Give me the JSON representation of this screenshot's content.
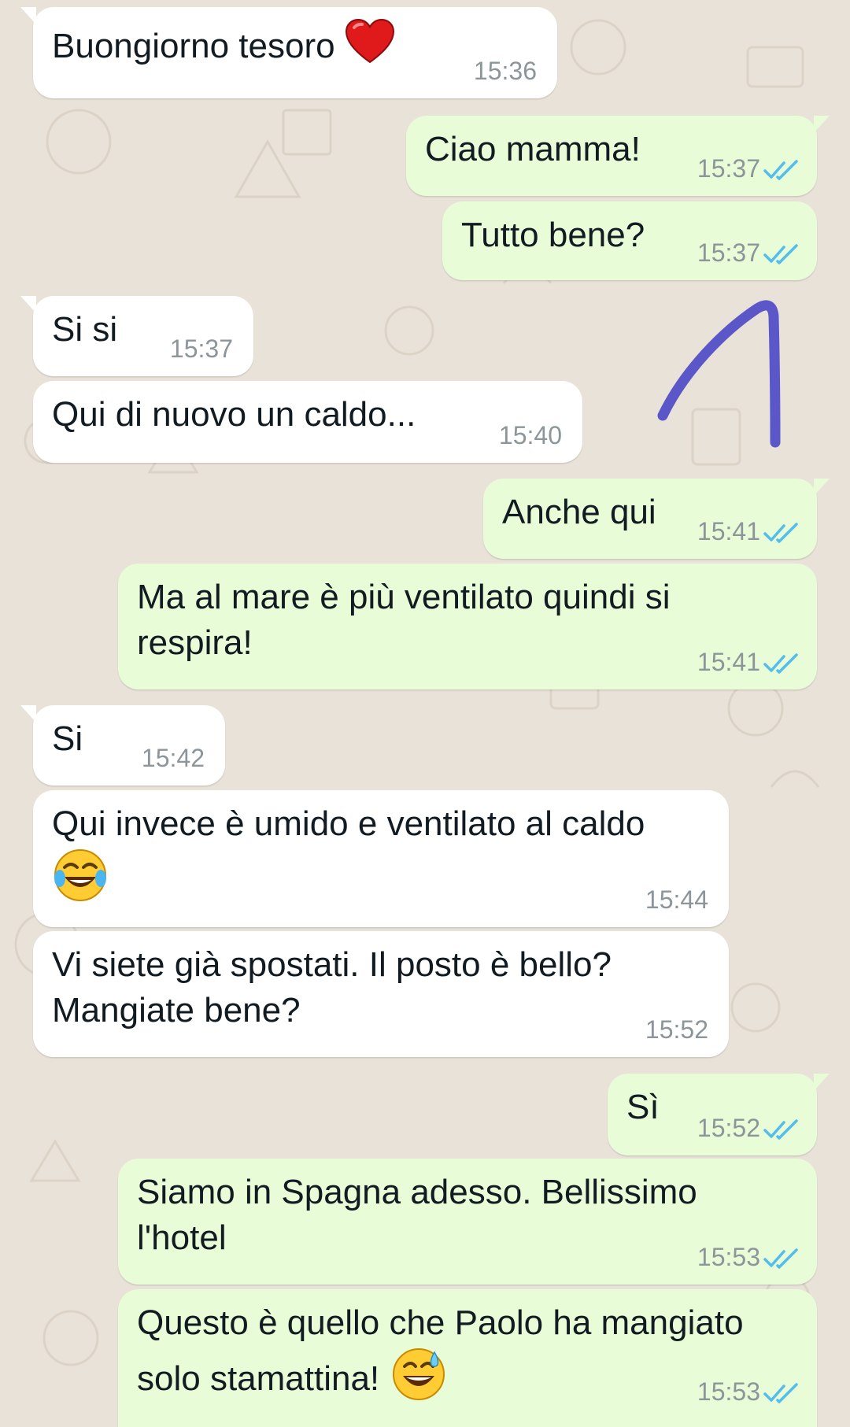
{
  "chat": {
    "messages": [
      {
        "dir": "in",
        "text": "Buongiorno tesoro",
        "emoji": "red-heart",
        "time": "15:36"
      },
      {
        "dir": "out",
        "text": "Ciao mamma!",
        "time": "15:37",
        "status": "read"
      },
      {
        "dir": "out",
        "text": "Tutto bene?",
        "time": "15:37",
        "status": "read"
      },
      {
        "dir": "in",
        "text": "Si si",
        "time": "15:37"
      },
      {
        "dir": "in",
        "text": "Qui di nuovo un caldo...",
        "time": "15:40"
      },
      {
        "dir": "out",
        "text": "Anche qui",
        "time": "15:41",
        "status": "read"
      },
      {
        "dir": "out",
        "text": "Ma al mare è più ventilato quindi si\nrespira!",
        "time": "15:41",
        "status": "read"
      },
      {
        "dir": "in",
        "text": "Si",
        "time": "15:42"
      },
      {
        "dir": "in",
        "text": "Qui invece è umido e ventilato al caldo",
        "emoji": "face-with-tears-of-joy",
        "time": "15:44"
      },
      {
        "dir": "in",
        "text": "Vi siete già spostati. Il posto è bello?\nMangiate bene?",
        "time": "15:52"
      },
      {
        "dir": "out",
        "text": "Sì",
        "time": "15:52",
        "status": "read"
      },
      {
        "dir": "out",
        "text": "Siamo in Spagna adesso. Bellissimo\nl'hotel",
        "time": "15:53",
        "status": "read"
      },
      {
        "dir": "out",
        "text": "Questo è quello che Paolo ha mangiato\nsolo stamattina!",
        "emoji": "grinning-face-with-sweat",
        "time": "15:53",
        "status": "read"
      }
    ]
  },
  "colors": {
    "wallpaper": "#e9e2d8",
    "incoming_bubble": "#ffffff",
    "outgoing_bubble": "#e8fcd7",
    "read_ticks": "#53bdeb",
    "annotation_stroke": "#5b57c9"
  }
}
